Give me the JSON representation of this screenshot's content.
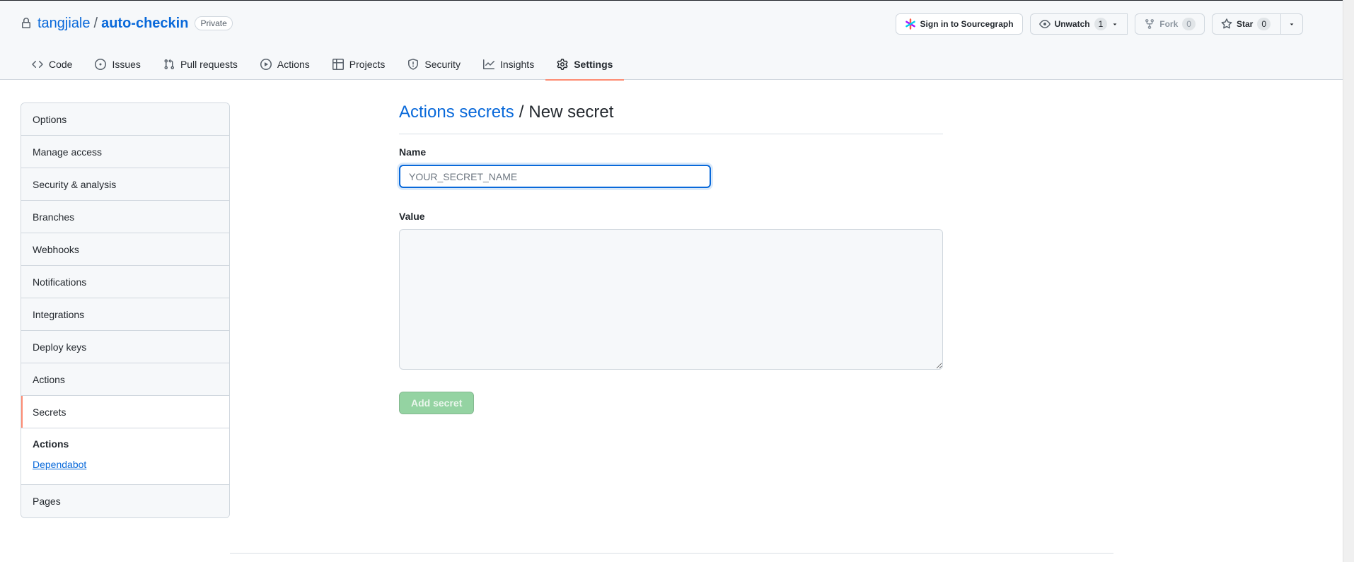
{
  "repo": {
    "owner": "tangjiale",
    "separator": "/",
    "name": "auto-checkin",
    "visibility": "Private"
  },
  "header_actions": {
    "sourcegraph_label": "Sign in to Sourcegraph",
    "unwatch_label": "Unwatch",
    "unwatch_count": "1",
    "fork_label": "Fork",
    "fork_count": "0",
    "star_label": "Star",
    "star_count": "0"
  },
  "tabs": [
    {
      "label": "Code",
      "icon": "code-icon"
    },
    {
      "label": "Issues",
      "icon": "issue-icon"
    },
    {
      "label": "Pull requests",
      "icon": "pull-request-icon"
    },
    {
      "label": "Actions",
      "icon": "play-icon"
    },
    {
      "label": "Projects",
      "icon": "table-icon"
    },
    {
      "label": "Security",
      "icon": "shield-icon"
    },
    {
      "label": "Insights",
      "icon": "graph-icon"
    },
    {
      "label": "Settings",
      "icon": "gear-icon",
      "active": true
    }
  ],
  "sidebar": {
    "items": [
      {
        "label": "Options"
      },
      {
        "label": "Manage access"
      },
      {
        "label": "Security & analysis"
      },
      {
        "label": "Branches"
      },
      {
        "label": "Webhooks"
      },
      {
        "label": "Notifications"
      },
      {
        "label": "Integrations"
      },
      {
        "label": "Deploy keys"
      },
      {
        "label": "Actions"
      },
      {
        "label": "Secrets",
        "active": true
      }
    ],
    "secrets_sub": {
      "heading": "Actions",
      "link": "Dependabot"
    },
    "last_item": "Pages"
  },
  "main": {
    "heading_link": "Actions secrets",
    "heading_sep": "/",
    "heading_current": "New secret",
    "name_label": "Name",
    "name_placeholder": "YOUR_SECRET_NAME",
    "name_value": "",
    "value_label": "Value",
    "value_text": "",
    "submit_label": "Add secret"
  },
  "colors": {
    "accent": "#0969da",
    "active_tab_underline": "#fd8c73",
    "submit_disabled": "#94d3a2"
  }
}
